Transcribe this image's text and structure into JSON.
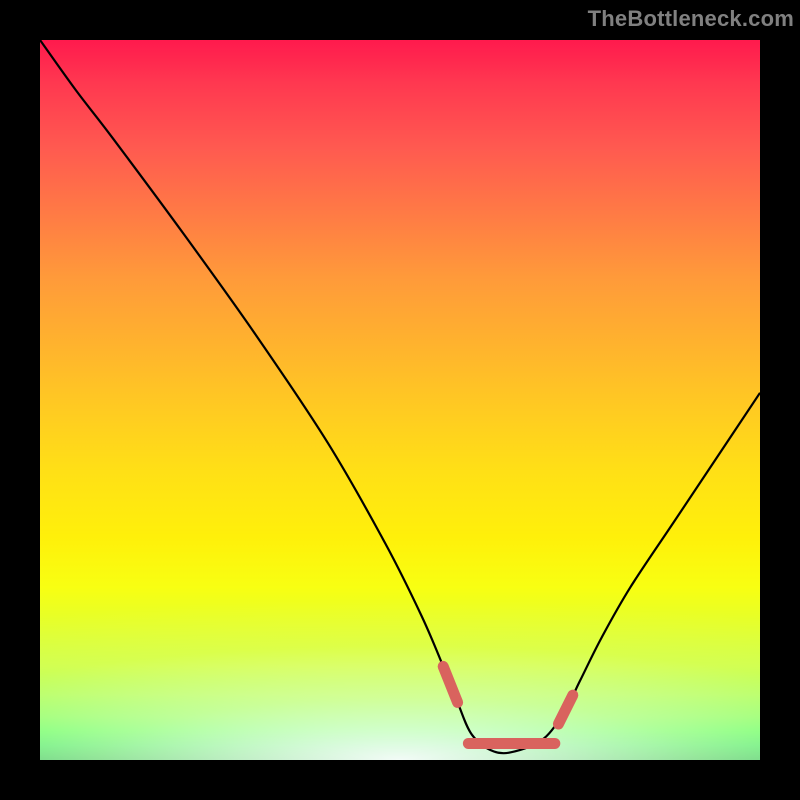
{
  "watermark": "TheBottleneck.com",
  "chart_data": {
    "type": "line",
    "title": "",
    "xlabel": "",
    "ylabel": "",
    "xlim": [
      0,
      100
    ],
    "ylim": [
      0,
      100
    ],
    "grid": false,
    "series": [
      {
        "name": "bottleneck-curve",
        "x": [
          0,
          5,
          10,
          20,
          30,
          40,
          48,
          53,
          56,
          58,
          60,
          63,
          66,
          70,
          73,
          75,
          78,
          82,
          88,
          94,
          100
        ],
        "values": [
          100,
          93,
          86.5,
          73,
          59,
          44,
          30,
          20,
          13,
          8,
          3.5,
          1.2,
          1.2,
          3,
          7,
          11,
          17,
          24,
          33,
          42,
          51
        ]
      }
    ],
    "highlight": {
      "name": "optimal-range",
      "color": "#d9635e",
      "x_range": [
        56,
        73
      ],
      "segments": [
        {
          "x": [
            56,
            58
          ],
          "values": [
            13,
            8
          ]
        },
        {
          "x": [
            59.5,
            71.5
          ],
          "values": [
            2.3,
            2.3
          ]
        },
        {
          "x": [
            72,
            74
          ],
          "values": [
            5,
            9
          ]
        }
      ]
    }
  },
  "colors": {
    "curve": "#000000",
    "highlight": "#d9635e",
    "background_border": "#000000"
  }
}
